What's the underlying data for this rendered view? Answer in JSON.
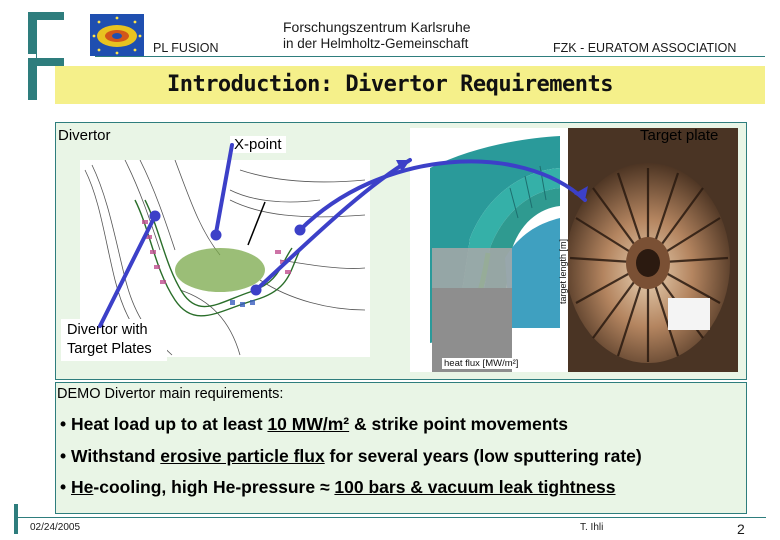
{
  "header": {
    "logo_label": "PL FUSION",
    "org_line1": "Forschungszentrum Karlsruhe",
    "org_line2": "in der Helmholtz-Gemeinschaft",
    "association": "FZK - EURATOM ASSOCIATION"
  },
  "title": "Introduction: Divertor Requirements",
  "figure": {
    "divertor_label": "Divertor",
    "xpoint_label": "X-point",
    "target_plate_label": "Target plate",
    "divertor_with_plates_line1": "Divertor with",
    "divertor_with_plates_line2": "Target Plates",
    "target_length_label": "target length [m]",
    "heat_flux_label": "heat flux [MW/m²]"
  },
  "requirements": {
    "heading": "DEMO Divertor main requirements:",
    "items": [
      {
        "bullet": "•",
        "pre": "Heat load up to at least ",
        "u1": "10 MW/m²",
        "post": " & strike point movements"
      },
      {
        "bullet": "•",
        "pre": "Withstand ",
        "u1": "erosive particle flux",
        "post": " for several years (low sputtering rate)"
      },
      {
        "bullet": "•",
        "u0": "He",
        "pre": "-cooling, high He-pressure ≈ ",
        "u1": "100 bars & vacuum leak tightness",
        "post": ""
      }
    ]
  },
  "footer": {
    "date": "02/24/2005",
    "author": "T. Ihli",
    "page": "2"
  },
  "colors": {
    "frame": "#2e7d7d",
    "title_band": "#f5f08a",
    "panel_bg": "#e9f5e6",
    "arrow": "#3c40c8"
  }
}
